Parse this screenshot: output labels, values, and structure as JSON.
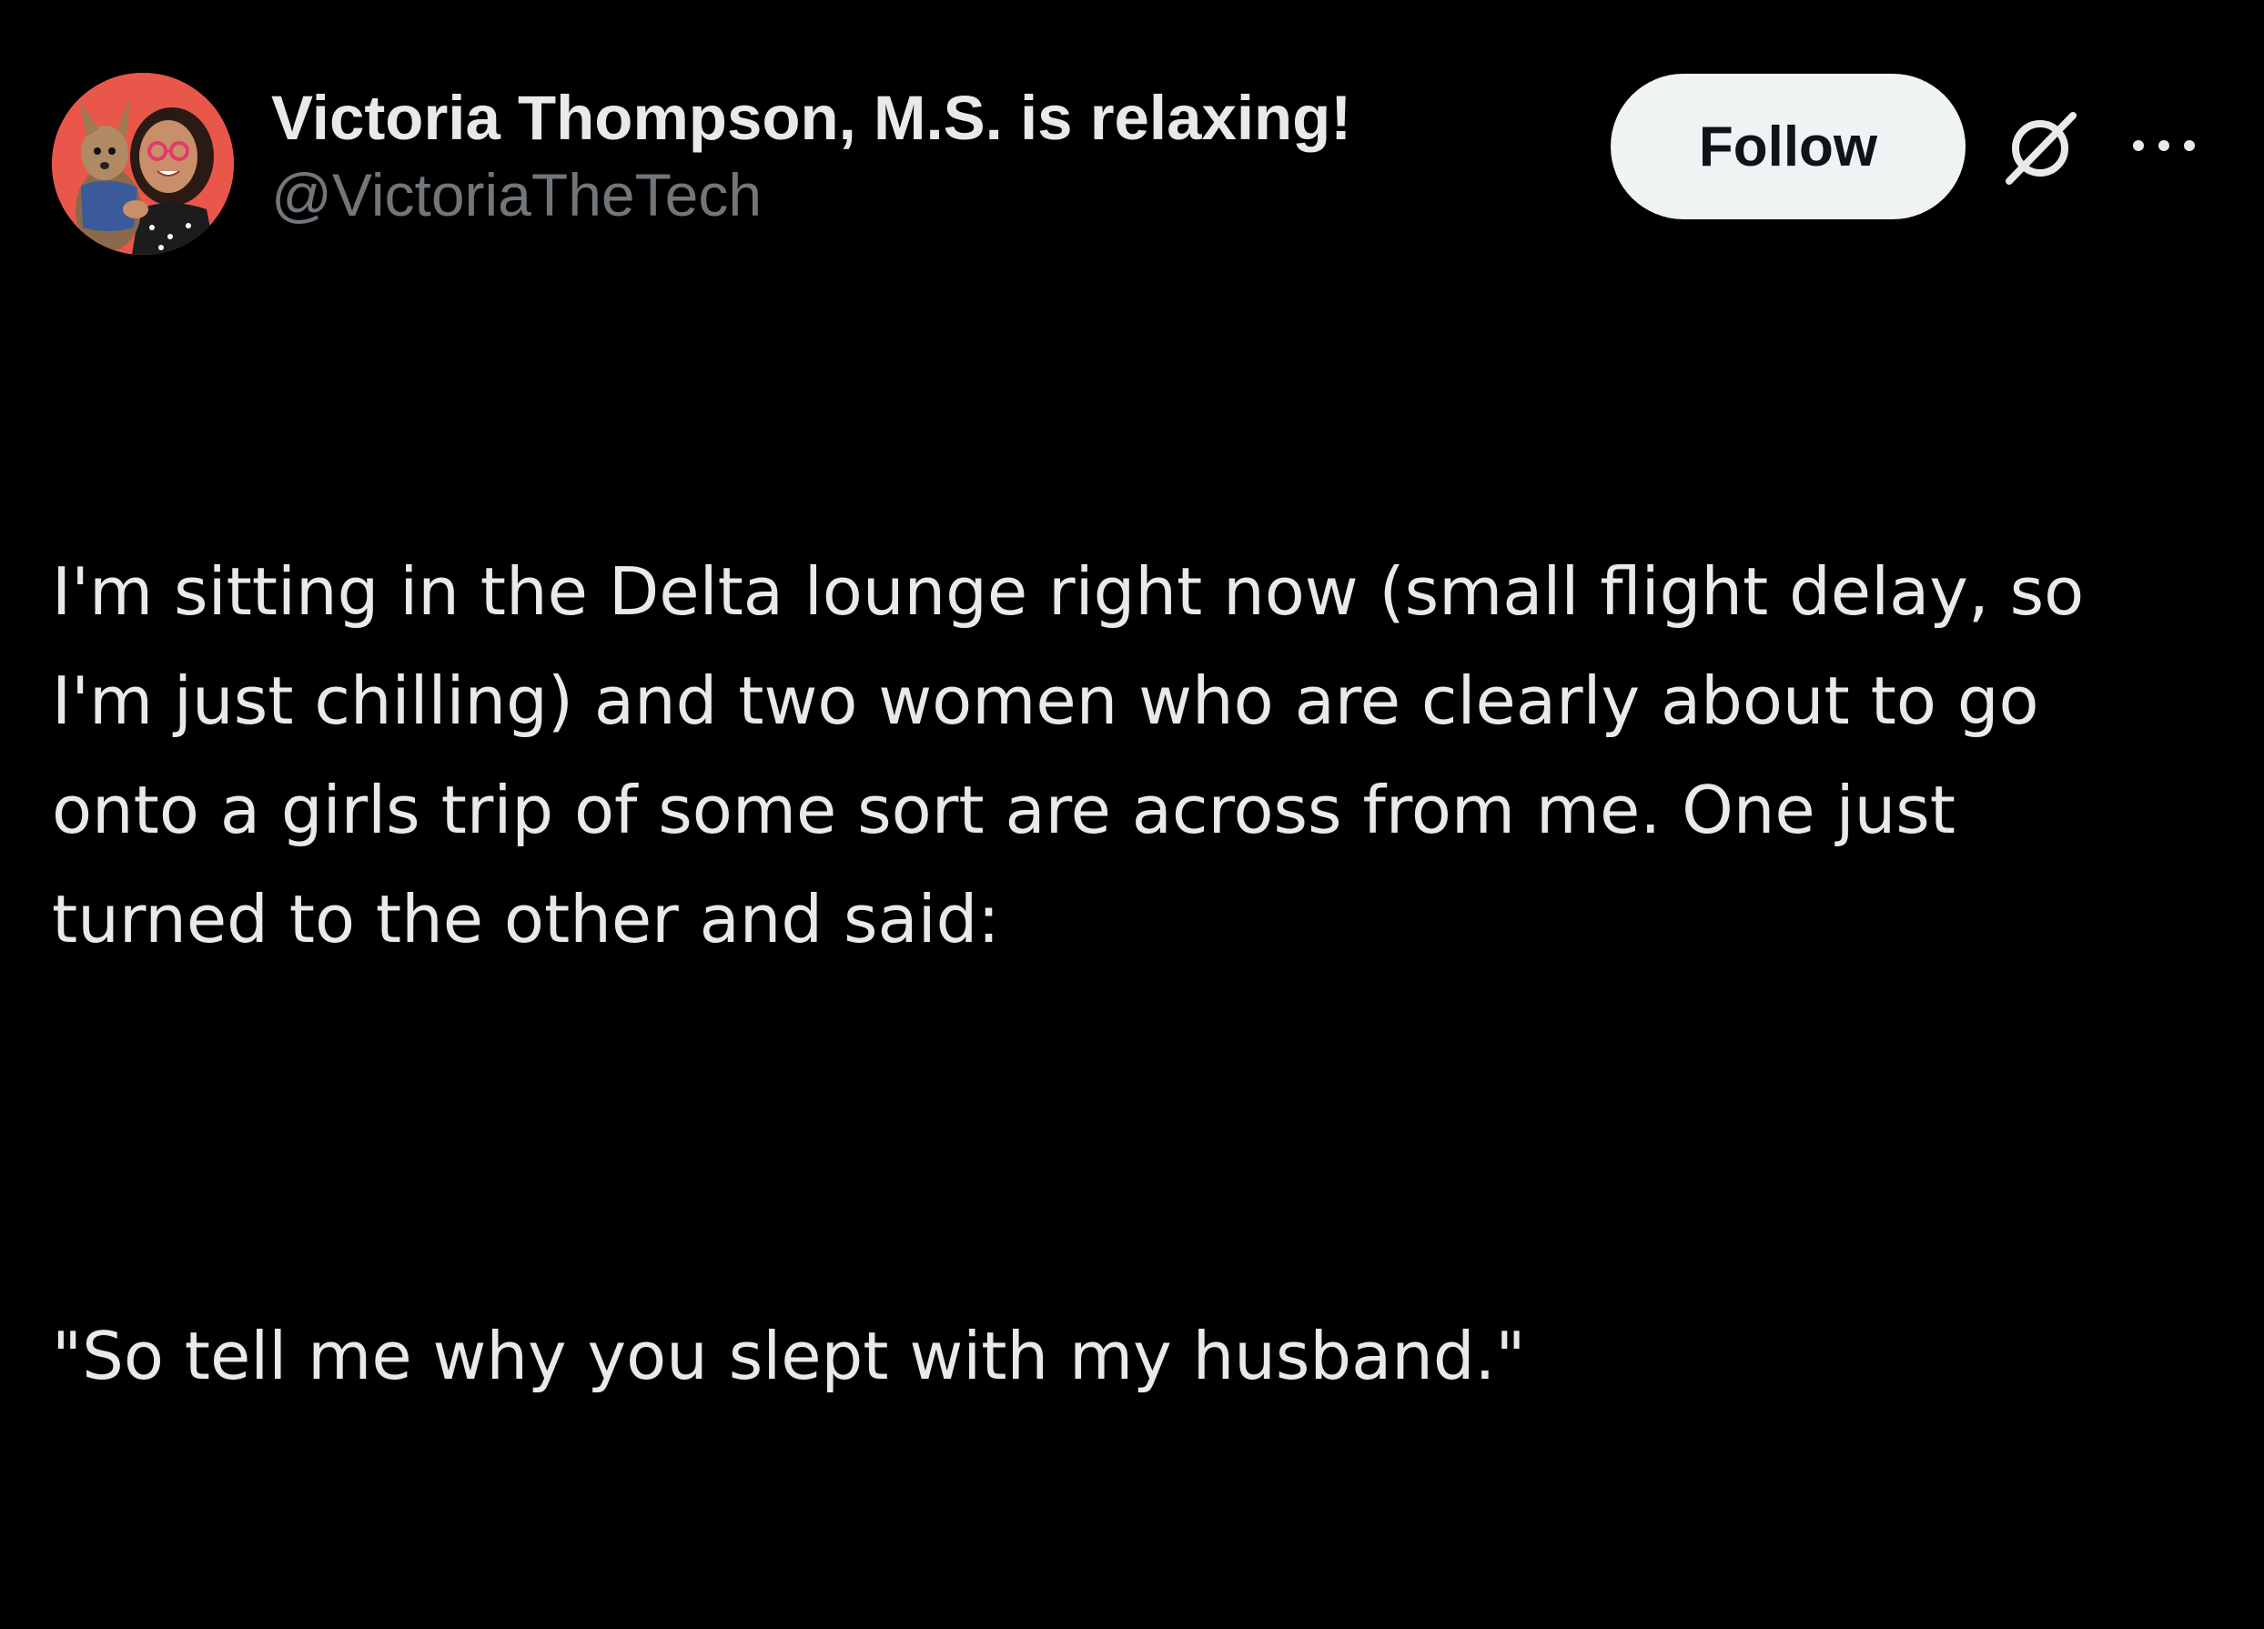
{
  "tweet": {
    "author": {
      "display_name": "Victoria Thompson, M.S. is relaxing!",
      "handle": "@VictoriaTheTech"
    },
    "follow_label": "Follow",
    "icons": {
      "grok": "grok-icon",
      "more": "more-icon"
    },
    "body": {
      "paragraph": "I'm sitting in the Delta lounge right now (small flight delay, so\nI'm just chilling) and two women who are clearly about to go\nonto a girls trip of some sort are across from me. One just\nturned to the other and said:",
      "quote": "\"So tell me why you slept with my husband.\""
    }
  },
  "colors": {
    "background": "#000000",
    "primary_text": "#e7e9ea",
    "secondary_text": "#71767b",
    "follow_button_bg": "#eff3f4",
    "follow_button_text": "#0f1419",
    "avatar_bg": "#e8574a"
  }
}
